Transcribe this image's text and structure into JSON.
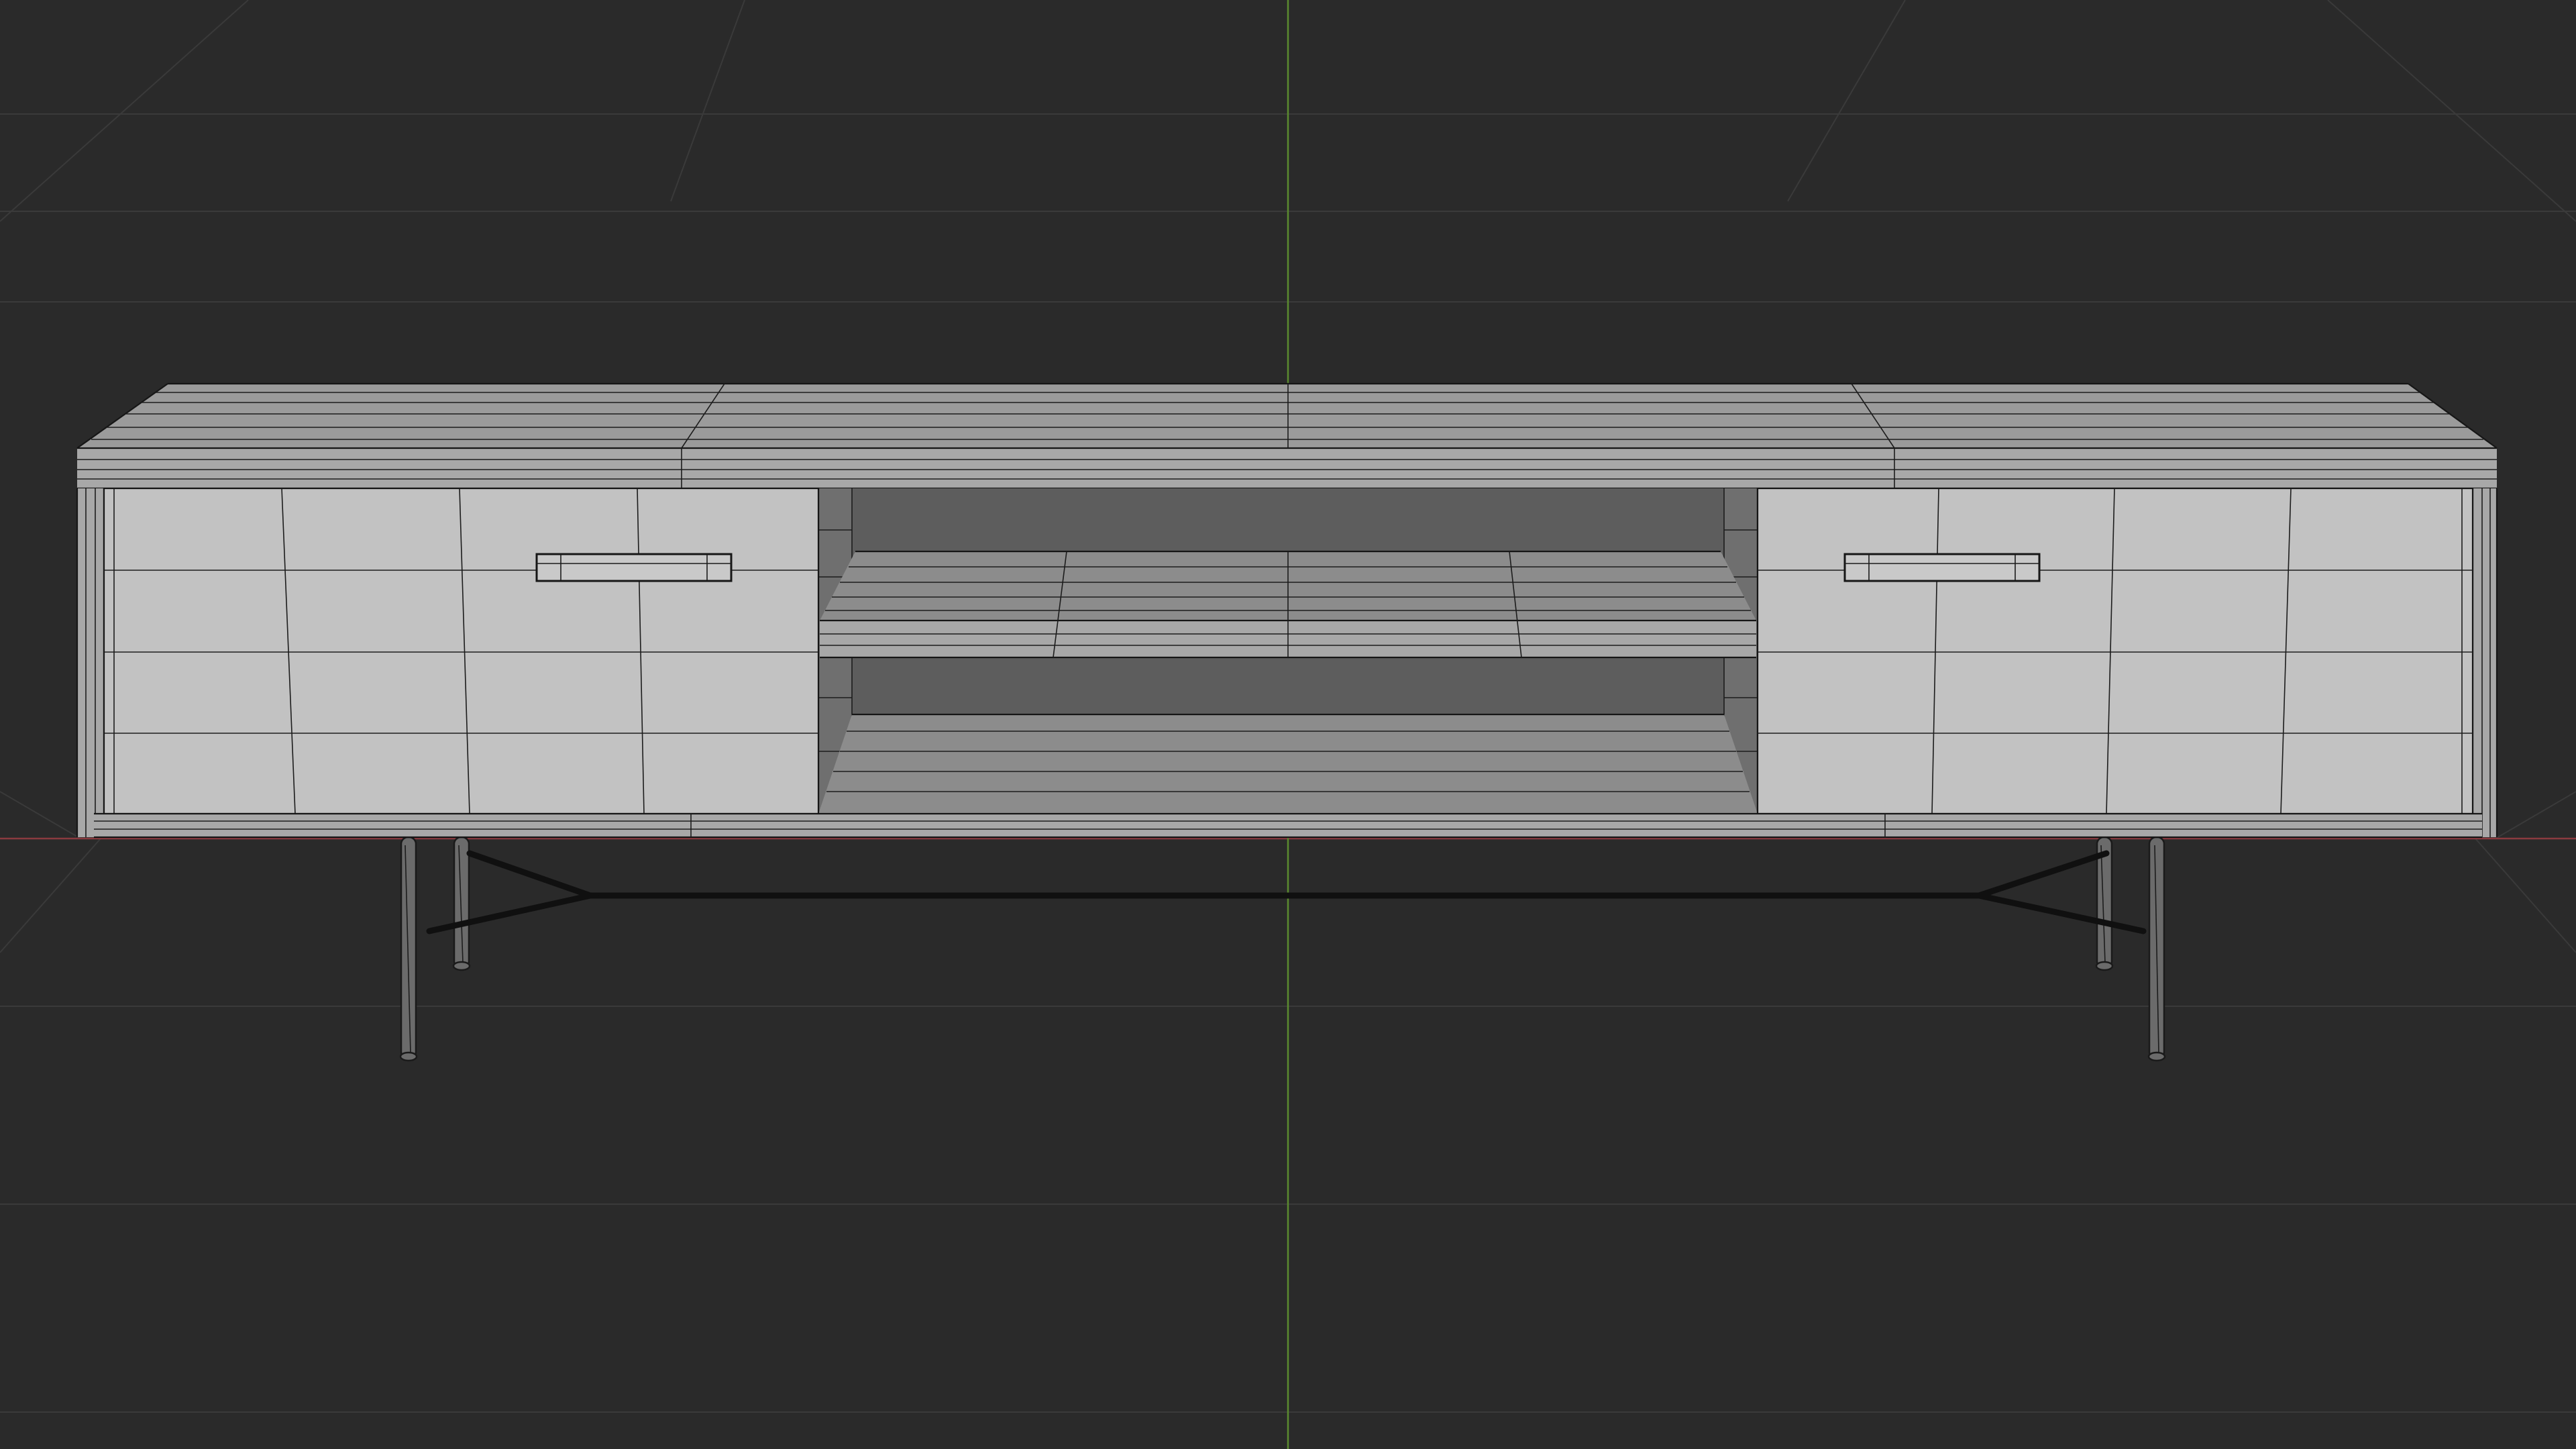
{
  "app": {
    "view": "3D viewport",
    "shading": "solid-wireframe"
  },
  "colors": {
    "background": "#2a2a2a",
    "grid": "#3a3a3a",
    "x_axis": "#8a3a3f",
    "y_axis": "#5b8a2f",
    "wire": "#161616",
    "mesh_surface": "#c2c2c2"
  },
  "scene": {
    "object": "sideboard-mesh",
    "parts": [
      "top-panel",
      "left-door",
      "right-door",
      "open-compartment",
      "middle-shelf",
      "bottom-panel",
      "handles",
      "metal-legs",
      "stretcher-bar"
    ]
  }
}
